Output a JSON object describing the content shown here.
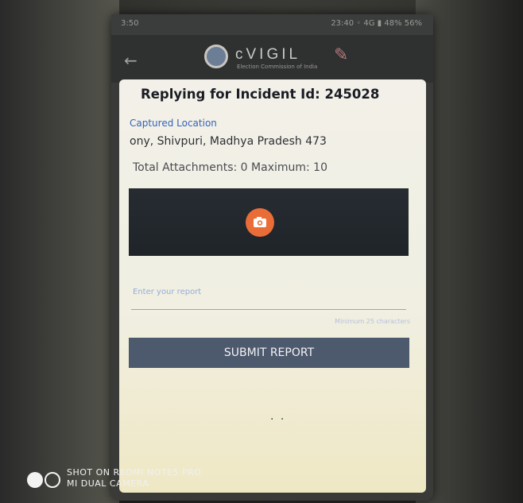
{
  "statusbar": {
    "left": "3:50",
    "right": "23:40  ◦ 4G  ▮ 48%  56%"
  },
  "appbar": {
    "logo_text": "cVIGIL",
    "logo_sub": "Election Commission of India"
  },
  "report": {
    "title": "Replying for Incident Id: 245028",
    "location_label": "Captured Location",
    "location_value": "ony, Shivpuri, Madhya Pradesh 473",
    "attachments": "Total Attachments: 0 Maximum: 10",
    "input_placeholder": "Enter your report",
    "min_hint": "Minimum 25 characters",
    "submit_label": "SUBMIT REPORT"
  },
  "watermark": {
    "line1": "SHOT ON REDMI NOTE5 PRO",
    "line2": "MI DUAL CAMERA"
  },
  "colors": {
    "accent_orange": "#ea6d38",
    "submit_bg": "#4d596d",
    "link_blue": "#3564b8"
  },
  "icons": {
    "back": "arrow-left-icon",
    "camera": "camera-icon",
    "logo": "cvigil-logo-icon",
    "pencil": "pencil-icon"
  }
}
